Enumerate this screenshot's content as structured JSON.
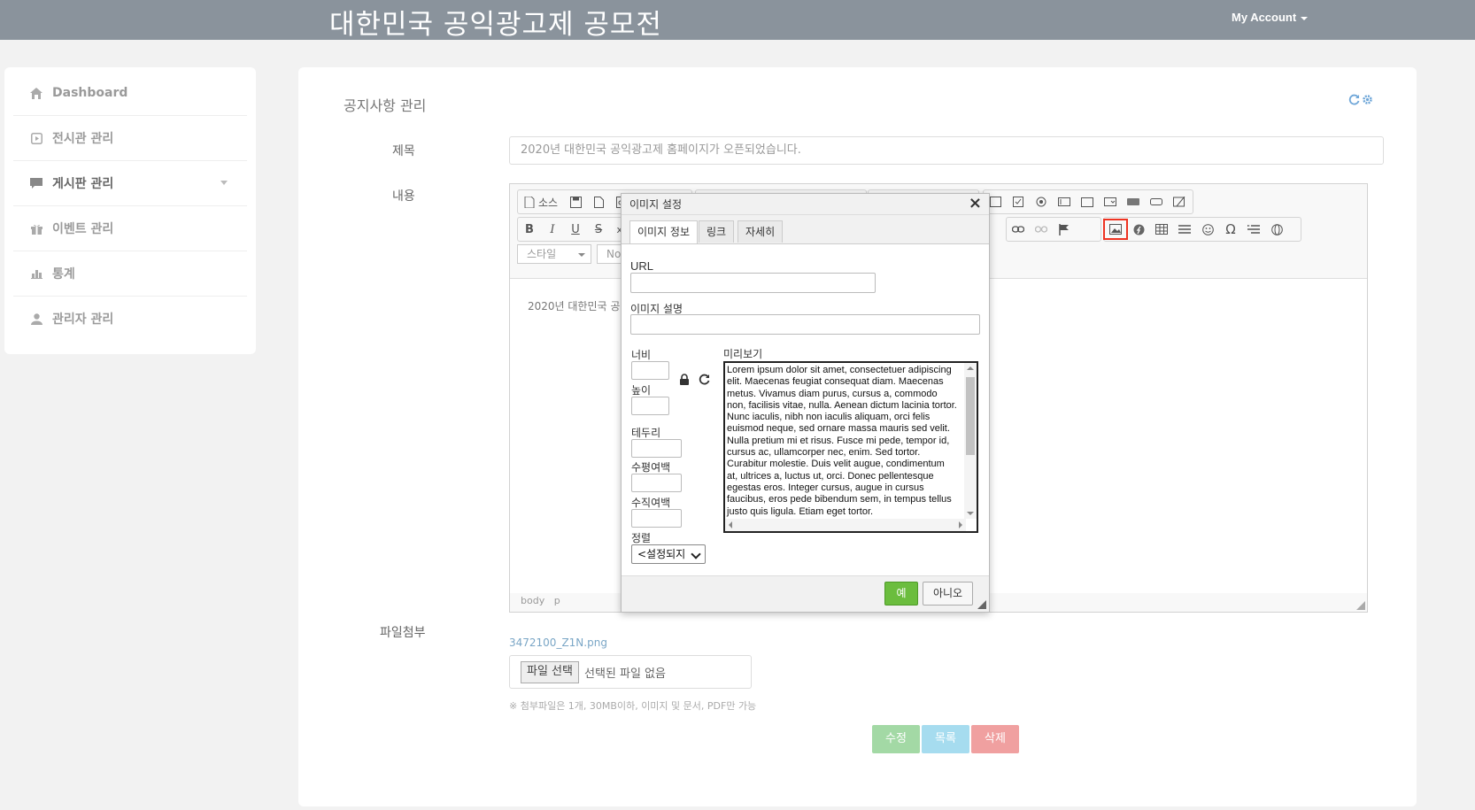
{
  "header": {
    "site_title": "대한민국 공익광고제 공모전",
    "account": "My Account"
  },
  "sidebar": {
    "items": [
      {
        "label": "Dashboard",
        "icon": "home-icon"
      },
      {
        "label": "전시관 관리",
        "icon": "play-square-icon"
      },
      {
        "label": "게시판 관리",
        "icon": "comment-icon",
        "has_submenu": true
      },
      {
        "label": "이벤트 관리",
        "icon": "gift-icon"
      },
      {
        "label": "통계",
        "icon": "bar-chart-icon"
      },
      {
        "label": "관리자 관리",
        "icon": "user-icon"
      }
    ]
  },
  "main": {
    "title": "공지사항 관리",
    "labels": {
      "subject": "제목",
      "content": "내용",
      "attachment": "파일첨부"
    },
    "subject_value": "2020년 대한민국 공익광고제 홈페이지가 오픈되었습니다.",
    "editor": {
      "source_label": "소스",
      "style_label": "스타일",
      "format_label": "Norm",
      "content": "2020년 대한민국 공익",
      "status": [
        "body",
        "p"
      ]
    },
    "attachment": {
      "file_name": "3472100_Z1N.png",
      "choose_label": "파일 선택",
      "no_file": "선택된 파일 없음",
      "hint": "※ 첨부파일은 1개, 30MB이하, 이미지 및 문서, PDF만 가능"
    },
    "buttons": {
      "edit": "수정",
      "list": "목록",
      "delete": "삭제"
    }
  },
  "dialog": {
    "title": "이미지 설정",
    "tabs": [
      "이미지 정보",
      "링크",
      "자세히"
    ],
    "labels": {
      "url": "URL",
      "alt": "이미지 설명",
      "width": "너비",
      "height": "높이",
      "border": "테두리",
      "hspace": "수평여백",
      "vspace": "수직여백",
      "align": "정렬",
      "preview": "미리보기"
    },
    "align_value": "<설정되지",
    "preview_text": "Lorem ipsum dolor sit amet, consectetuer adipiscing elit. Maecenas feugiat consequat diam. Maecenas metus. Vivamus diam purus, cursus a, commodo non, facilisis vitae, nulla. Aenean dictum lacinia tortor. Nunc iaculis, nibh non iaculis aliquam, orci felis euismod neque, sed ornare massa mauris sed velit. Nulla pretium mi et risus. Fusce mi pede, tempor id, cursus ac, ullamcorper nec, enim. Sed tortor. Curabitur molestie. Duis velit augue, condimentum at, ultrices a, luctus ut, orci. Donec pellentesque egestas eros. Integer cursus, augue in cursus faucibus, eros pede bibendum sem, in tempus tellus justo quis ligula. Etiam eget tortor.",
    "ok": "예",
    "cancel": "아니오"
  },
  "colors": {
    "header_bg": "#8a939c",
    "btn_edit": "#a3d9a5",
    "btn_list": "#a6dcef",
    "btn_delete": "#f0a0a0",
    "ok_btn": "#6bbd3e",
    "highlight": "#e32222"
  }
}
